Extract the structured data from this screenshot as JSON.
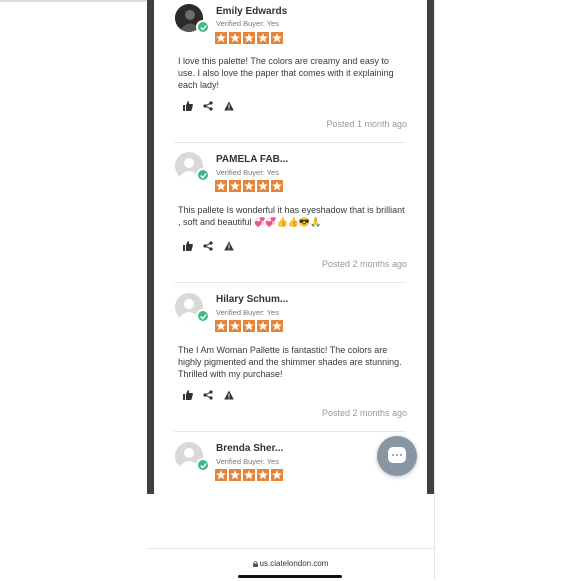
{
  "reviews": [
    {
      "name": "Emily Edwards",
      "verified": "Verified Buyer: Yes",
      "body": "I love this palette! The colors are creamy and easy to use. I also love the paper that comes with it explaining each lady!",
      "posted": "Posted 1 month ago",
      "rating": 5,
      "avatar": "photo"
    },
    {
      "name": "PAMELA FAB...",
      "verified": "Verified Buyer: Yes",
      "body": "This pallete Is wonderful it has eyeshadow that is brilliant , soft and beautiful 💞💞👍👍😎🙏",
      "posted": "Posted 2 months ago",
      "rating": 5,
      "avatar": "default"
    },
    {
      "name": "Hilary Schum...",
      "verified": "Verified Buyer: Yes",
      "body": "The I Am Woman Pallette is fantastic! The colors are highly pigmented and the shimmer shades are stunning. Thrilled with my purchase!",
      "posted": "Posted 2 months ago",
      "rating": 5,
      "avatar": "default"
    },
    {
      "name": "Brenda Sher...",
      "verified": "Verified Buyer: Yes",
      "rating": 5,
      "avatar": "default"
    }
  ],
  "browser": {
    "url": "us.ciatelondon.com"
  },
  "colors": {
    "star": "#e8833a",
    "verified_check": "#3fb883",
    "chat_button": "#8796a4"
  }
}
